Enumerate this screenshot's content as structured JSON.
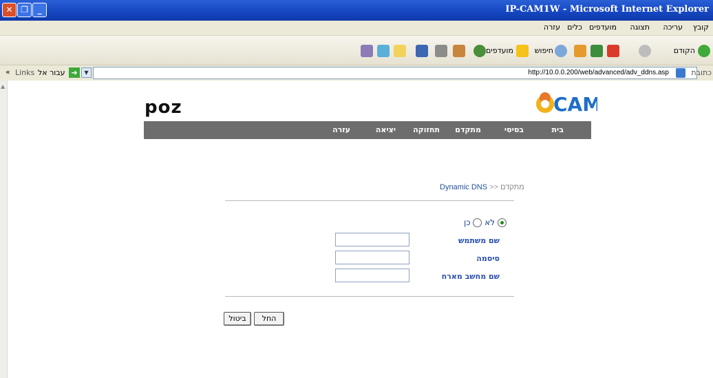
{
  "window": {
    "title": "IP-CAM1W - Microsoft Internet Explorer"
  },
  "menu": [
    "קובץ",
    "עריכה",
    "תצוגה",
    "מועדפים",
    "כלים",
    "עזרה"
  ],
  "toolbar": {
    "back": "הקודם",
    "search": "חיפוש",
    "favorites": "מועדפים"
  },
  "links": {
    "label": "Links",
    "go": "עבור אל"
  },
  "address": {
    "label": "כתובת",
    "url": "http://10.0.0.200/web/advanced/adv_ddns.asp"
  },
  "brand": {
    "left_logo": "poz",
    "right_logo": "CAM"
  },
  "nav": {
    "home": "בית",
    "basic": "בסיסי",
    "advanced": "מתקדם",
    "maintenance": "תחזוקה",
    "exit": "יציאה",
    "help": "עזרה"
  },
  "breadcrumb": {
    "parent": "מתקדם",
    "sep": ">>",
    "current": "Dynamic DNS"
  },
  "ddns": {
    "enable_yes": "כן",
    "enable_no": "לא",
    "enabled": true,
    "username_label": "שם משתמש",
    "password_label": "סיסמה",
    "hostname_label": "שם מחשב מארח"
  },
  "actions": {
    "apply": "החל",
    "cancel": "ביטול"
  },
  "colors": {
    "nav": "#6d6d6d",
    "link": "#1f4f9e",
    "label": "#2a4fae",
    "title_bar": "#1546c0"
  }
}
